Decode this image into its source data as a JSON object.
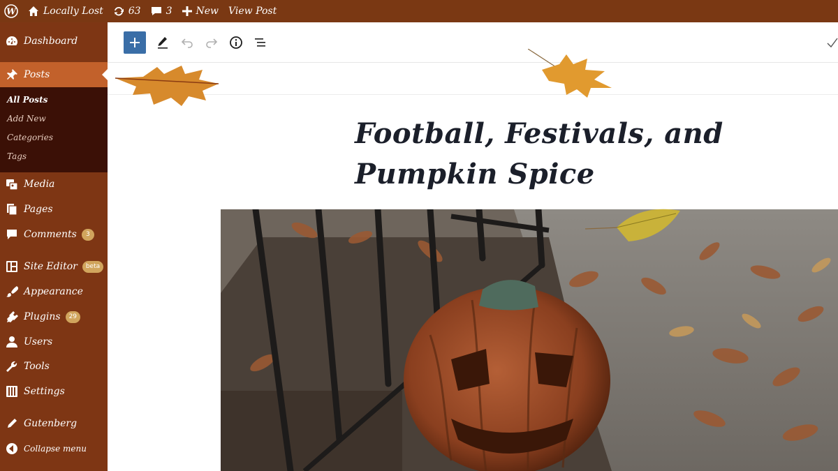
{
  "adminbar": {
    "site_name": "Locally Lost",
    "updates_count": "63",
    "comments_count": "3",
    "new_label": "New",
    "view_post_label": "View Post"
  },
  "sidebar": {
    "dashboard": "Dashboard",
    "posts": "Posts",
    "posts_submenu": [
      "All Posts",
      "Add New",
      "Categories",
      "Tags"
    ],
    "media": "Media",
    "pages": "Pages",
    "comments": "Comments",
    "comments_badge": "3",
    "site_editor": "Site Editor",
    "site_editor_badge": "beta",
    "appearance": "Appearance",
    "plugins": "Plugins",
    "plugins_badge": "29",
    "users": "Users",
    "tools": "Tools",
    "settings": "Settings",
    "gutenberg": "Gutenberg",
    "collapse": "Collapse menu"
  },
  "editor": {
    "post_title": "Football, Festivals, and Pumpkin Spice"
  },
  "colors": {
    "adminbar": "#7a3813",
    "sidebar": "#7e3614",
    "sidebar_current": "#c2612b",
    "submenu": "#3b1006",
    "inserter": "#3a6ea7",
    "badge": "#d1a55d"
  }
}
